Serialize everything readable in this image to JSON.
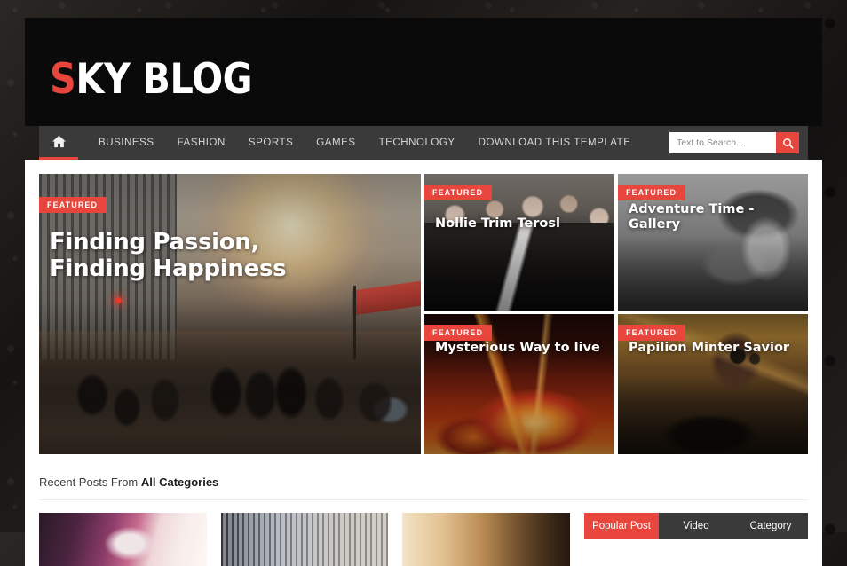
{
  "header": {
    "logo_accent": "S",
    "logo_rest": "KY BLOG"
  },
  "nav": {
    "home_icon": "home-icon",
    "items": [
      {
        "label": "BUSINESS"
      },
      {
        "label": "FASHION"
      },
      {
        "label": "SPORTS"
      },
      {
        "label": "GAMES"
      },
      {
        "label": "TECHNOLOGY"
      },
      {
        "label": "DOWNLOAD THIS TEMPLATE"
      }
    ],
    "search": {
      "placeholder": "Text to Search...",
      "value": "",
      "button_icon": "search-icon"
    }
  },
  "featured": {
    "badge_label": "FEATURED",
    "main": {
      "title": "Finding Passion, Finding Happiness",
      "title_line1": "Finding Passion,",
      "title_line2": "Finding Happiness",
      "image": "city-street-crowd-sunset"
    },
    "tiles": [
      {
        "title": "Nollie Trim Terosl",
        "image": "men-in-suits-sunglasses"
      },
      {
        "title": "Adventure Time - Gallery",
        "title_line1": "Adventure Time -",
        "title_line2": "Gallery",
        "image": "beach-portrait-grayscale"
      },
      {
        "title": "Mysterious Way to live",
        "image": "fire-flames-closeup"
      },
      {
        "title": "Papilion Minter Savior",
        "image": "dj-turntable-headphones"
      }
    ]
  },
  "recent": {
    "prefix": "Recent Posts From ",
    "strong": "All Categories"
  },
  "posts": [
    {
      "image": "purple-hair-portrait"
    },
    {
      "image": "architecture-facade"
    },
    {
      "image": "warm-interior"
    }
  ],
  "sidebar": {
    "tabs": [
      {
        "label": "Popular Post",
        "active": true
      },
      {
        "label": "Video",
        "active": false
      },
      {
        "label": "Category",
        "active": false
      }
    ]
  },
  "colors": {
    "accent_red": "#e8453c",
    "header_black": "#0a0a0a",
    "nav_gray": "#3a3a3a",
    "page_bg": "#1c1a19"
  }
}
